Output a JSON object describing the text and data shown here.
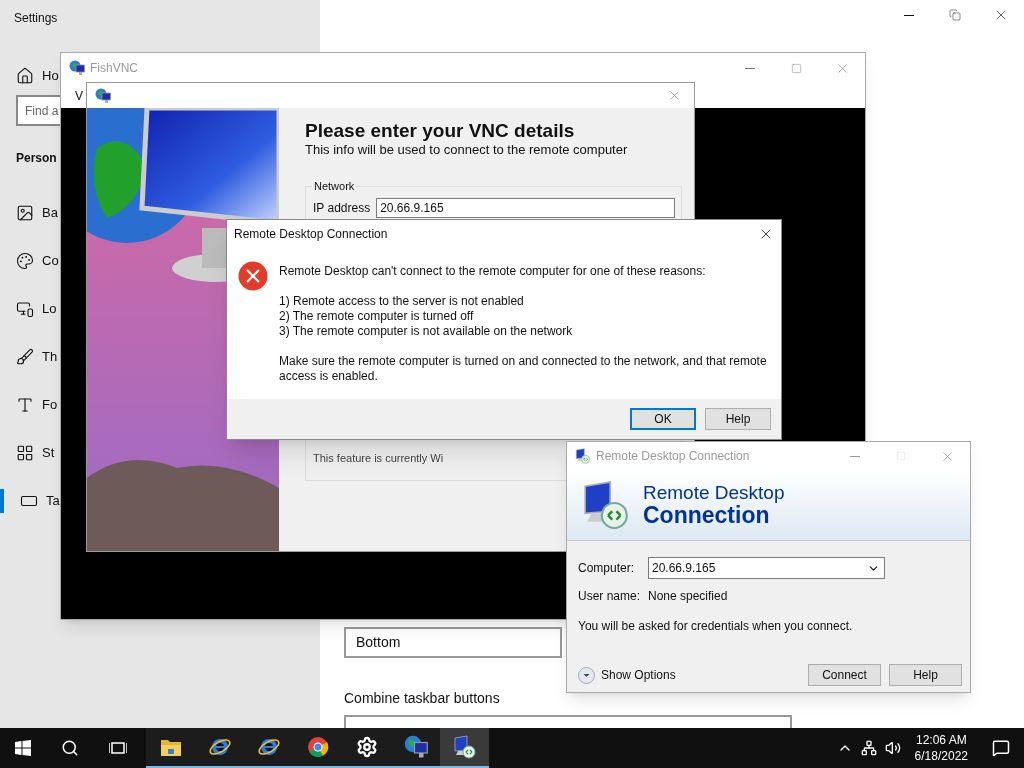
{
  "settings": {
    "title": "Settings",
    "home": "Ho",
    "search_placeholder": "Find a",
    "section": "Person",
    "items": [
      {
        "kind": "background",
        "label": "Ba",
        "selected": false
      },
      {
        "kind": "colors",
        "label": "Co",
        "selected": false
      },
      {
        "kind": "lock",
        "label": "Lo",
        "selected": false
      },
      {
        "kind": "themes",
        "label": "Th",
        "selected": false
      },
      {
        "kind": "fonts",
        "label": "Fo",
        "selected": false
      },
      {
        "kind": "start",
        "label": "St",
        "selected": false
      },
      {
        "kind": "taskbar",
        "label": "Ta",
        "selected": true
      }
    ],
    "location_value": "Bottom",
    "combine_label": "Combine taskbar buttons"
  },
  "fishvnc": {
    "title": "FishVNC",
    "menu": [
      "V"
    ]
  },
  "vnc_dialog": {
    "heading": "Please enter your VNC details",
    "subheading": "This info will be used to connect to the remote computer",
    "group": "Network",
    "ip_label": "IP address",
    "ip_value": "20.66.9.165",
    "note": "This feature is currently Wi"
  },
  "error_dialog": {
    "title": "Remote Desktop Connection",
    "message": "Remote Desktop can't connect to the remote computer for one of these reasons:",
    "reasons": [
      "1) Remote access to the server is not enabled",
      "2) The remote computer is turned off",
      "3) The remote computer is not available on the network"
    ],
    "advice": "Make sure the remote computer is turned on and connected to the network, and that remote access is enabled.",
    "buttons": [
      {
        "label": "OK",
        "default": true
      },
      {
        "label": "Help",
        "default": false
      }
    ]
  },
  "rdc": {
    "title": "Remote Desktop Connection",
    "banner_line1": "Remote Desktop",
    "banner_line2": "Connection",
    "computer_label": "Computer:",
    "computer_value": "20.66.9.165",
    "username_label": "User name:",
    "username_value": "None specified",
    "hint": "You will be asked for credentials when you connect.",
    "show_options": "Show Options",
    "buttons": [
      "Connect",
      "Help"
    ]
  },
  "taskbar": {
    "apps": [
      {
        "kind": "folder",
        "selected": false
      },
      {
        "kind": "ie",
        "selected": false
      },
      {
        "kind": "ie",
        "selected": false
      },
      {
        "kind": "chrome",
        "selected": false
      },
      {
        "kind": "gear",
        "selected": false
      },
      {
        "kind": "globe",
        "selected": false
      },
      {
        "kind": "rdc",
        "selected": true
      }
    ],
    "time": "12:06 AM",
    "date": "6/18/2022"
  }
}
